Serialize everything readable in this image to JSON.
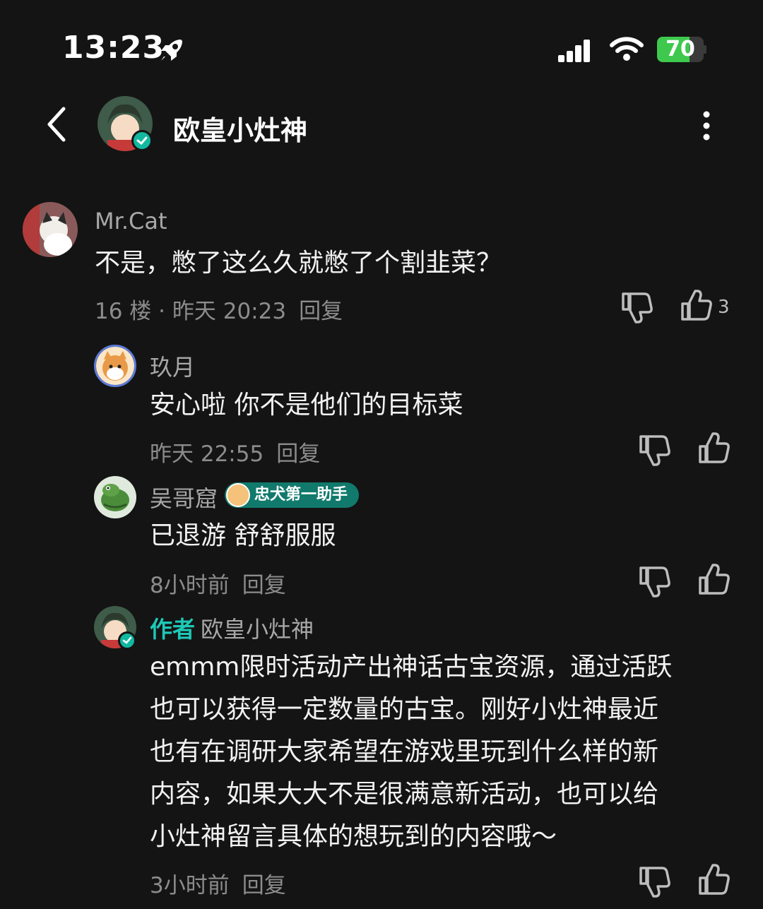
{
  "status_bar": {
    "time": "13:23",
    "battery": "70",
    "battery_level": 0.7
  },
  "header": {
    "title": "欧皇小灶神"
  },
  "comments": [
    {
      "username": "Mr.Cat",
      "text": "不是，憋了这么久就憋了个割韭菜？",
      "meta": "16 楼 · 昨天 20:23",
      "reply_label": "回复",
      "likes": "3"
    }
  ],
  "replies": [
    {
      "username": "玖月",
      "text": "安心啦 你不是他们的目标菜",
      "meta": "昨天 22:55",
      "reply_label": "回复"
    },
    {
      "username": "吴哥窟",
      "badge": "忠犬第一助手",
      "text": "已退游 舒舒服服",
      "meta": "8小时前",
      "reply_label": "回复"
    },
    {
      "author_tag": "作者",
      "username": "欧皇小灶神",
      "text_lines": [
        "emmm限时活动产出神话古宝资源，通过活跃",
        "也可以获得一定数量的古宝。刚好小灶神最近",
        "也有在调研大家希望在游戏里玩到什么样的新",
        "内容，如果大大不是很满意新活动，也可以给",
        "小灶神留言具体的想玩到的内容哦～"
      ],
      "meta": "3小时前",
      "reply_label": "回复"
    }
  ],
  "colors": {
    "background": "#141414",
    "accent": "#1dc9b7",
    "muted": "#8c8c8c"
  }
}
